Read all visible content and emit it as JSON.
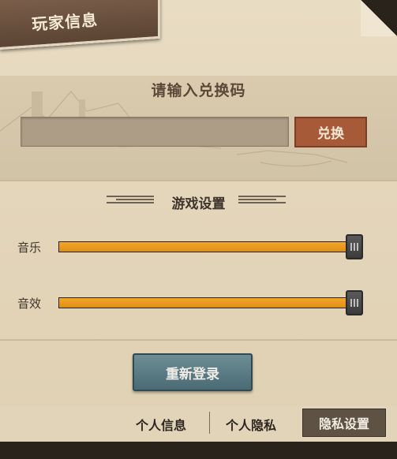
{
  "header": {
    "title": "玩家信息"
  },
  "redeem": {
    "heading": "请输入兑换码",
    "input_value": "",
    "button_label": "兑换"
  },
  "settings": {
    "heading": "游戏设置",
    "music": {
      "label": "音乐",
      "level": 1.0
    },
    "sfx": {
      "label": "音效",
      "level": 1.0
    }
  },
  "actions": {
    "relogin_label": "重新登录"
  },
  "footer": {
    "link1": "个人信息",
    "link2": "个人隐私",
    "privacy_button": "隐私设置"
  },
  "colors": {
    "accent": "#e89a1e",
    "redeem": "#a75a37",
    "relogin": "#5a7a84"
  }
}
